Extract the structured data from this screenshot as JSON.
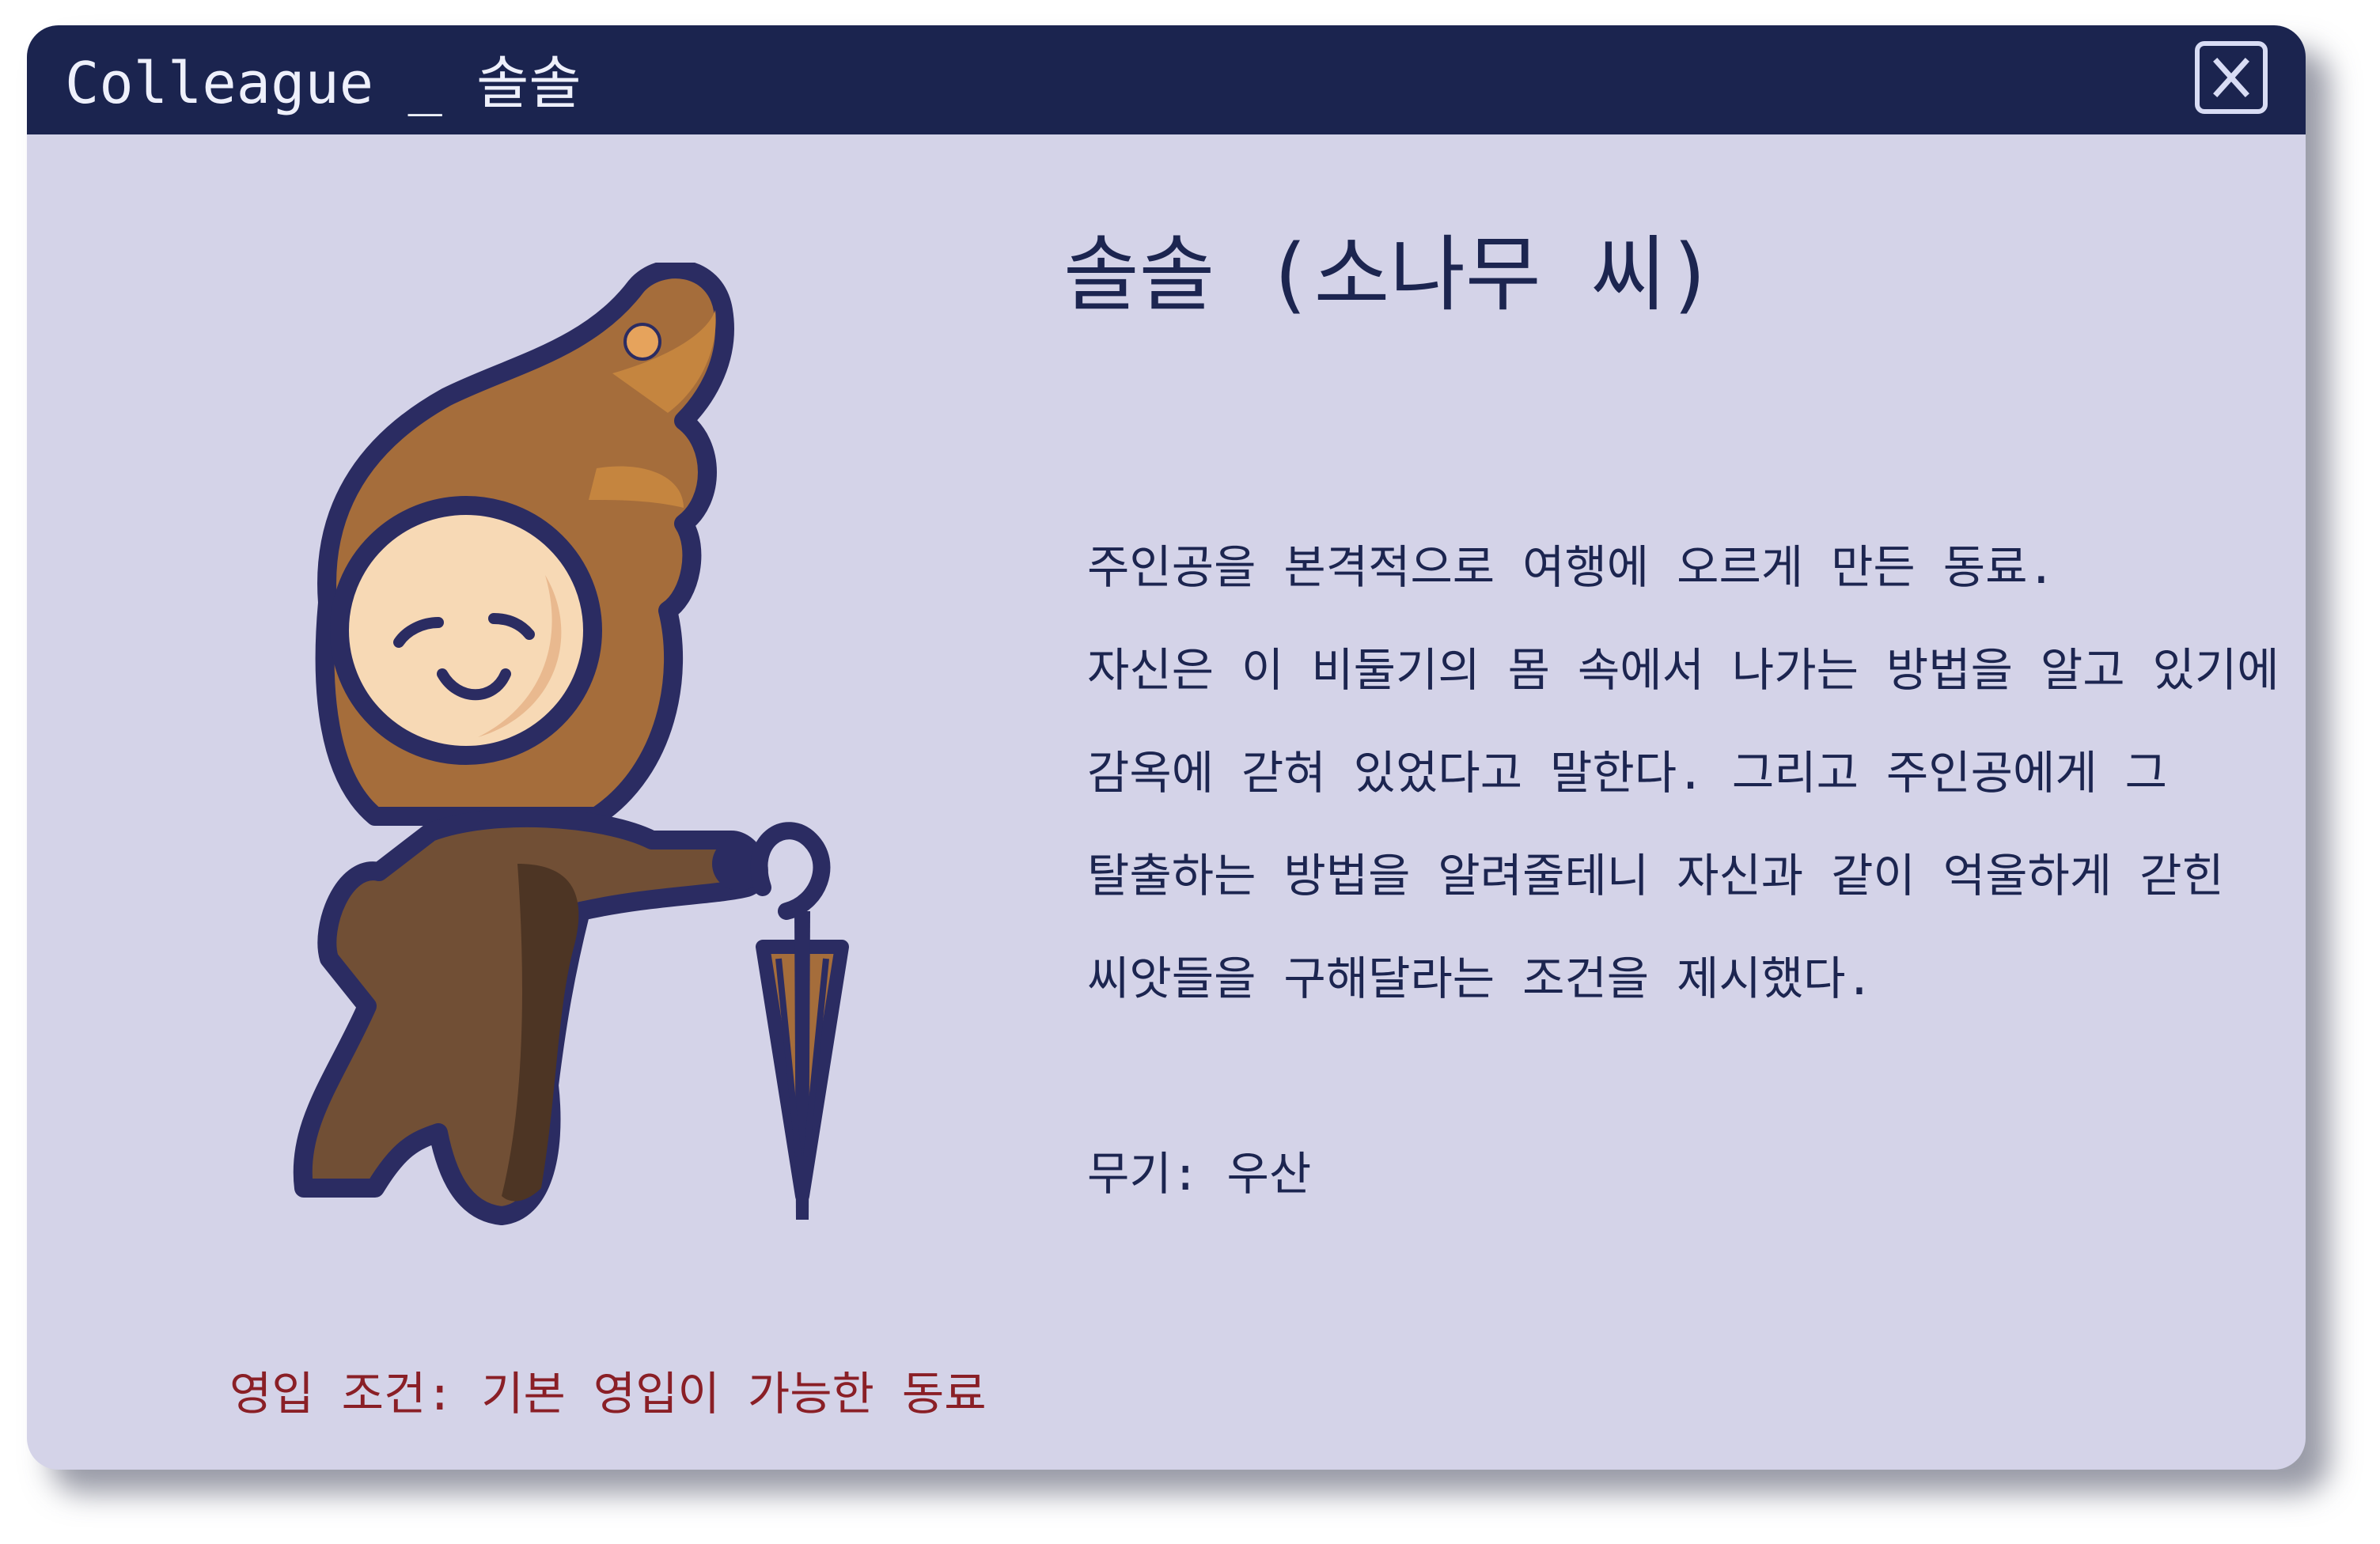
{
  "window": {
    "title": "Colleague _ 솔솔",
    "close_icon": "close-icon"
  },
  "character": {
    "name": "솔솔 (소나무 씨)",
    "description_lines": [
      "주인공을 본격적으로 여행에 오르게 만든 동료.",
      "자신은 이 비둘기의 몸 속에서 나가는 방법을 알고 있기에",
      "감옥에 갇혀 있었다고 말한다. 그리고 주인공에게 그",
      "탈출하는 방법을 알려줄테니 자신과 같이 억울하게 갇힌",
      "씨앗들을 구해달라는 조건을 제시했다."
    ],
    "weapon": "무기: 우산",
    "recruit_condition": "영입 조건: 기본 영입이 가능한 동료",
    "portrait": "pine-seed-character-with-umbrella"
  },
  "colors": {
    "title_bar": "#1b244f",
    "window_bg": "#d4d3e8",
    "text": "#1c2550",
    "condition_text": "#8a1f26",
    "character_brown": "#9e6b3c",
    "character_face": "#f7d9b5",
    "outline": "#2b2c62"
  }
}
